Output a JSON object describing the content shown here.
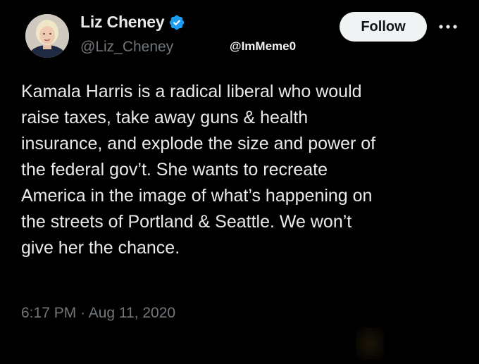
{
  "author": {
    "display_name": "Liz Cheney",
    "handle": "@Liz_Cheney",
    "avatar_icon": "avatar-photo",
    "verified_icon": "verified-badge-icon",
    "verified_color": "#1d9bf0"
  },
  "watermark": "@ImMeme0",
  "actions": {
    "follow_label": "Follow",
    "more_icon": "more-options-icon"
  },
  "tweet": {
    "lines": [
      "Kamala Harris is a radical liberal who would",
      "raise taxes, take away guns & health",
      "insurance, and explode the size and power of",
      "the federal gov’t. She wants to recreate",
      "America in the image of what’s happening on",
      "the streets of Portland & Seattle. We won’t",
      "give her the chance."
    ],
    "timestamp": "6:17 PM · Aug 11, 2020"
  },
  "colors": {
    "background": "#000000",
    "primary_text": "#e7e9ea",
    "secondary_text": "#71767b",
    "follow_bg": "#eff3f4",
    "follow_text": "#0f1419"
  }
}
